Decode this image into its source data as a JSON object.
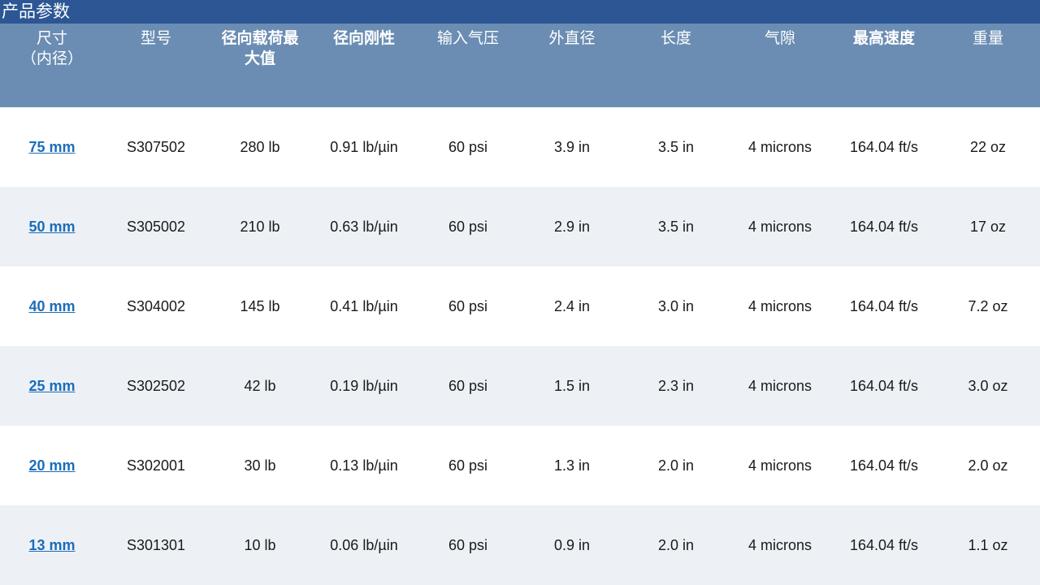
{
  "title": "产品参数",
  "colors": {
    "title_bar": "#2c5694",
    "header_bg": "#6b8db3",
    "row_shade": "#edf1f6",
    "link": "#1b6dba"
  },
  "headers": [
    {
      "lines": [
        "尺寸",
        "（内径）"
      ],
      "bold": false
    },
    {
      "lines": [
        "型号"
      ],
      "bold": false
    },
    {
      "lines": [
        "径向载荷最",
        "大值"
      ],
      "bold": true
    },
    {
      "lines": [
        "径向刚性"
      ],
      "bold": true
    },
    {
      "lines": [
        "输入气压"
      ],
      "bold": false
    },
    {
      "lines": [
        "外直径"
      ],
      "bold": false
    },
    {
      "lines": [
        "长度"
      ],
      "bold": false
    },
    {
      "lines": [
        "气隙"
      ],
      "bold": false
    },
    {
      "lines": [
        "最高速度"
      ],
      "bold": true
    },
    {
      "lines": [
        "重量"
      ],
      "bold": false
    }
  ],
  "rows": [
    [
      "75 mm",
      "S307502",
      "280 lb",
      "0.91 lb/µin",
      "60 psi",
      "3.9 in",
      "3.5 in",
      "4 microns",
      "164.04 ft/s",
      "22 oz"
    ],
    [
      "50 mm",
      "S305002",
      "210 lb",
      "0.63 lb/µin",
      "60 psi",
      "2.9 in",
      "3.5 in",
      "4 microns",
      "164.04 ft/s",
      "17 oz"
    ],
    [
      "40 mm",
      "S304002",
      "145 lb",
      "0.41 lb/µin",
      "60 psi",
      "2.4 in",
      "3.0 in",
      "4 microns",
      "164.04 ft/s",
      "7.2 oz"
    ],
    [
      "25 mm",
      "S302502",
      "42 lb",
      "0.19 lb/µin",
      "60 psi",
      "1.5 in",
      "2.3 in",
      "4 microns",
      "164.04 ft/s",
      "3.0 oz"
    ],
    [
      "20 mm",
      "S302001",
      "30 lb",
      "0.13 lb/µin",
      "60 psi",
      "1.3 in",
      "2.0 in",
      "4 microns",
      "164.04 ft/s",
      "2.0 oz"
    ],
    [
      "13 mm",
      "S301301",
      "10 lb",
      "0.06 lb/µin",
      "60 psi",
      "0.9 in",
      "2.0 in",
      "4 microns",
      "164.04 ft/s",
      "1.1 oz"
    ]
  ]
}
